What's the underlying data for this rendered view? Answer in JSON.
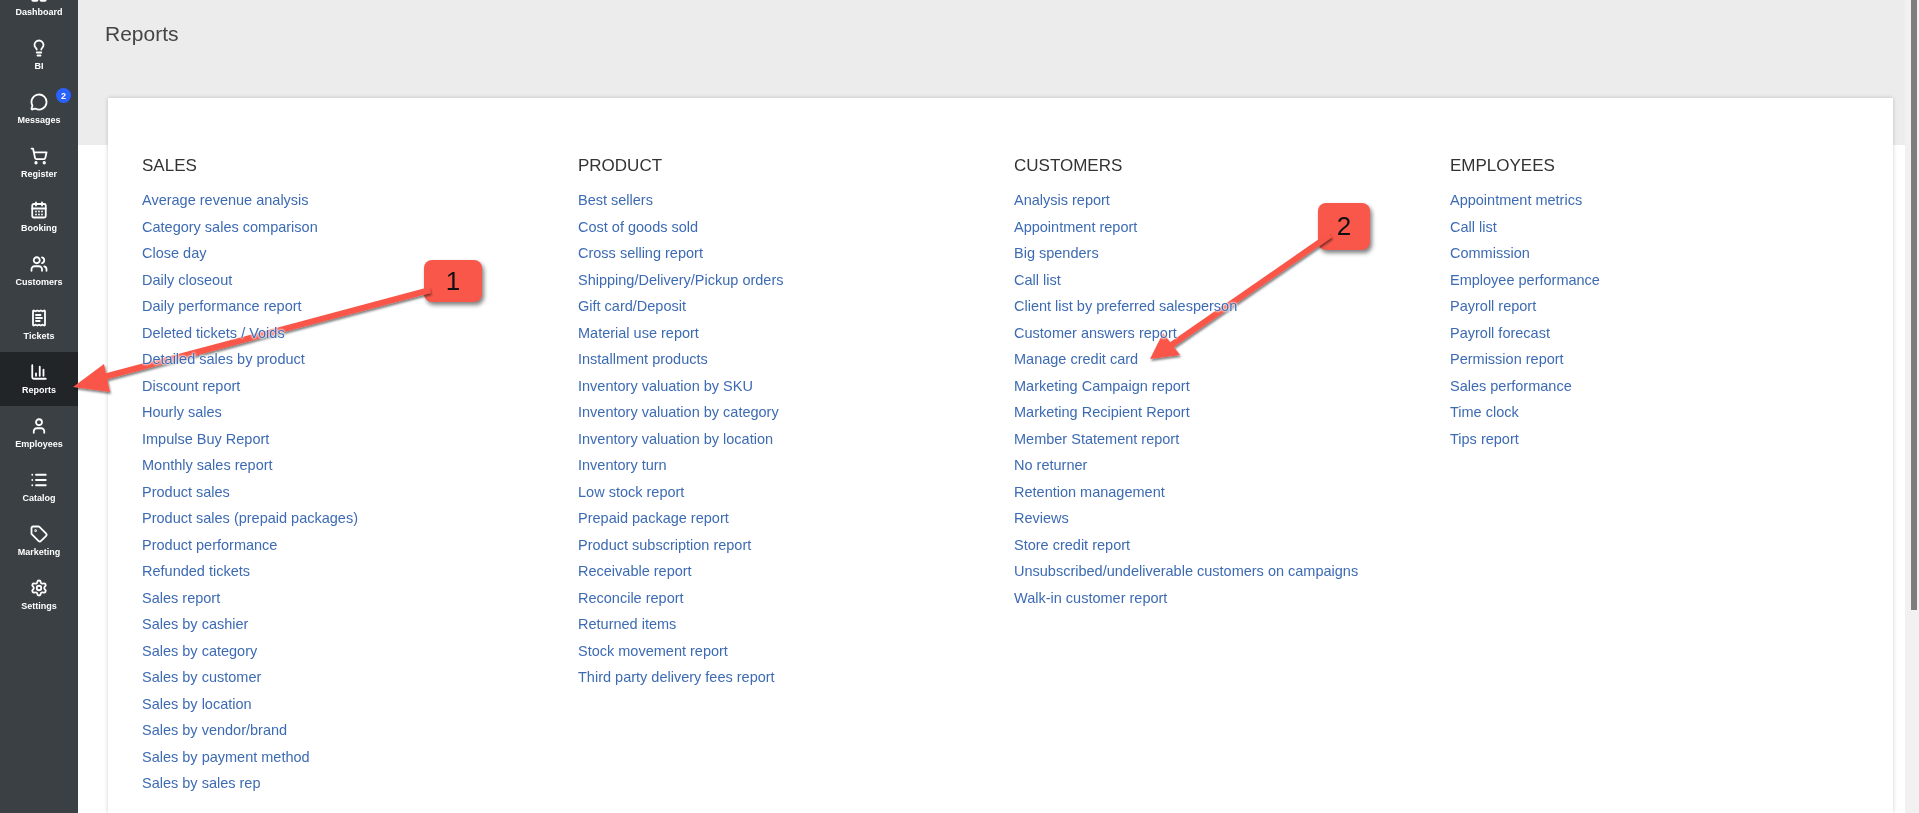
{
  "sidebar": {
    "items": [
      {
        "label": "Dashboard",
        "selected": false
      },
      {
        "label": "BI",
        "selected": false
      },
      {
        "label": "Messages",
        "selected": false,
        "badge": "2"
      },
      {
        "label": "Register",
        "selected": false
      },
      {
        "label": "Booking",
        "selected": false
      },
      {
        "label": "Customers",
        "selected": false
      },
      {
        "label": "Tickets",
        "selected": false
      },
      {
        "label": "Reports",
        "selected": true
      },
      {
        "label": "Employees",
        "selected": false
      },
      {
        "label": "Catalog",
        "selected": false
      },
      {
        "label": "Marketing",
        "selected": false
      },
      {
        "label": "Settings",
        "selected": false
      }
    ]
  },
  "page": {
    "title": "Reports"
  },
  "sections": [
    {
      "heading": "SALES",
      "links": [
        "Average revenue analysis",
        "Category sales comparison",
        "Close day",
        "Daily closeout",
        "Daily performance report",
        "Deleted tickets / Voids",
        "Detailed sales by product",
        "Discount report",
        "Hourly sales",
        "Impulse Buy Report",
        "Monthly sales report",
        "Product sales",
        "Product sales (prepaid packages)",
        "Product performance",
        "Refunded tickets",
        "Sales report",
        "Sales by cashier",
        "Sales by category",
        "Sales by customer",
        "Sales by location",
        "Sales by vendor/brand",
        "Sales by payment method",
        "Sales by sales rep"
      ]
    },
    {
      "heading": "PRODUCT",
      "links": [
        "Best sellers",
        "Cost of goods sold",
        "Cross selling report",
        "Shipping/Delivery/Pickup orders",
        "Gift card/Deposit",
        "Material use report",
        "Installment products",
        "Inventory valuation by SKU",
        "Inventory valuation by category",
        "Inventory valuation by location",
        "Inventory turn",
        "Low stock report",
        "Prepaid package report",
        "Product subscription report",
        "Receivable report",
        "Reconcile report",
        "Returned items",
        "Stock movement report",
        "Third party delivery fees report"
      ]
    },
    {
      "heading": "CUSTOMERS",
      "links": [
        "Analysis report",
        "Appointment report",
        "Big spenders",
        "Call list",
        "Client list by preferred salesperson",
        "Customer answers report",
        "Manage credit card",
        "Marketing Campaign report",
        "Marketing Recipient Report",
        "Member Statement report",
        "No returner",
        "Retention management",
        "Reviews",
        "Store credit report",
        "Unsubscribed/undeliverable customers on campaigns",
        "Walk-in customer report"
      ]
    },
    {
      "heading": "EMPLOYEES",
      "links": [
        "Appointment metrics",
        "Call list",
        "Commission",
        "Employee performance",
        "Payroll report",
        "Payroll forecast",
        "Permission report",
        "Sales performance",
        "Time clock",
        "Tips report"
      ]
    }
  ],
  "annotations": [
    {
      "label": "1"
    },
    {
      "label": "2"
    }
  ]
}
